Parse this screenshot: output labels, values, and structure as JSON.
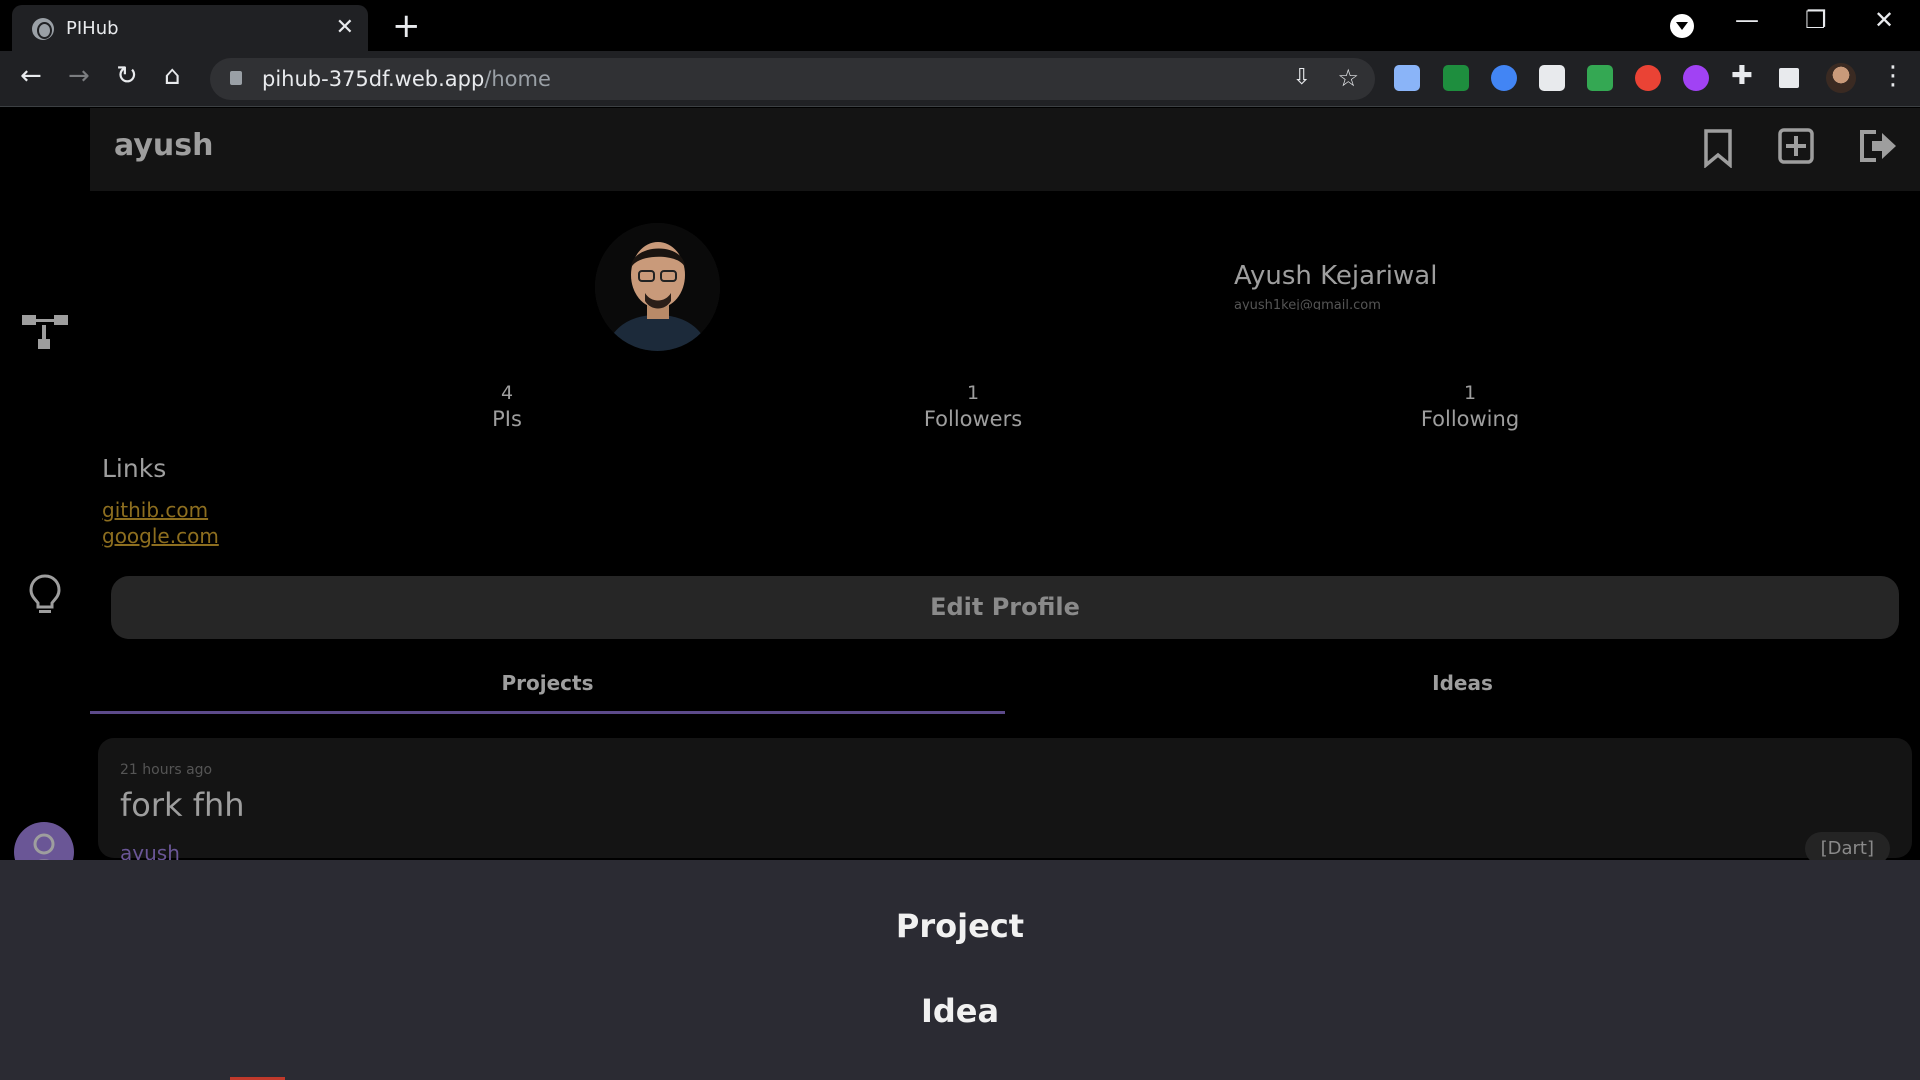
{
  "browser": {
    "tab_title": "PIHub",
    "tab_close": "✕",
    "new_tab": "+",
    "url_host": "pihub-375df.web.app",
    "url_path": "/home",
    "win_minimize": "—",
    "win_restore": "❐",
    "win_close": "✕",
    "extension_colors": [
      "#8ab4f8",
      "#1e8e3e",
      "#4285f4",
      "#e8eaed",
      "#34a853",
      "#ea4335",
      "#a142f4"
    ]
  },
  "topbar": {
    "username": "ayush"
  },
  "profile": {
    "name": "Ayush Kejariwal",
    "email": "ayush1kej@gmail.com",
    "stats": [
      {
        "value": "4",
        "label": "PIs"
      },
      {
        "value": "1",
        "label": "Followers"
      },
      {
        "value": "1",
        "label": "Following"
      }
    ],
    "links_title": "Links",
    "links": [
      "githib.com",
      "google.com"
    ],
    "edit_label": "Edit Profile"
  },
  "tabs": [
    {
      "label": "Projects",
      "active": true
    },
    {
      "label": "Ideas",
      "active": false
    }
  ],
  "feed": [
    {
      "time": "21 hours ago",
      "title": "fork fhh",
      "author": "ayush",
      "lang": "[Dart]"
    }
  ],
  "sheet": {
    "options": [
      "Project",
      "Idea"
    ]
  },
  "colors": {
    "accent": "#6a5696",
    "link": "#8d6e1f",
    "sheet_bg": "#2b2b33"
  }
}
